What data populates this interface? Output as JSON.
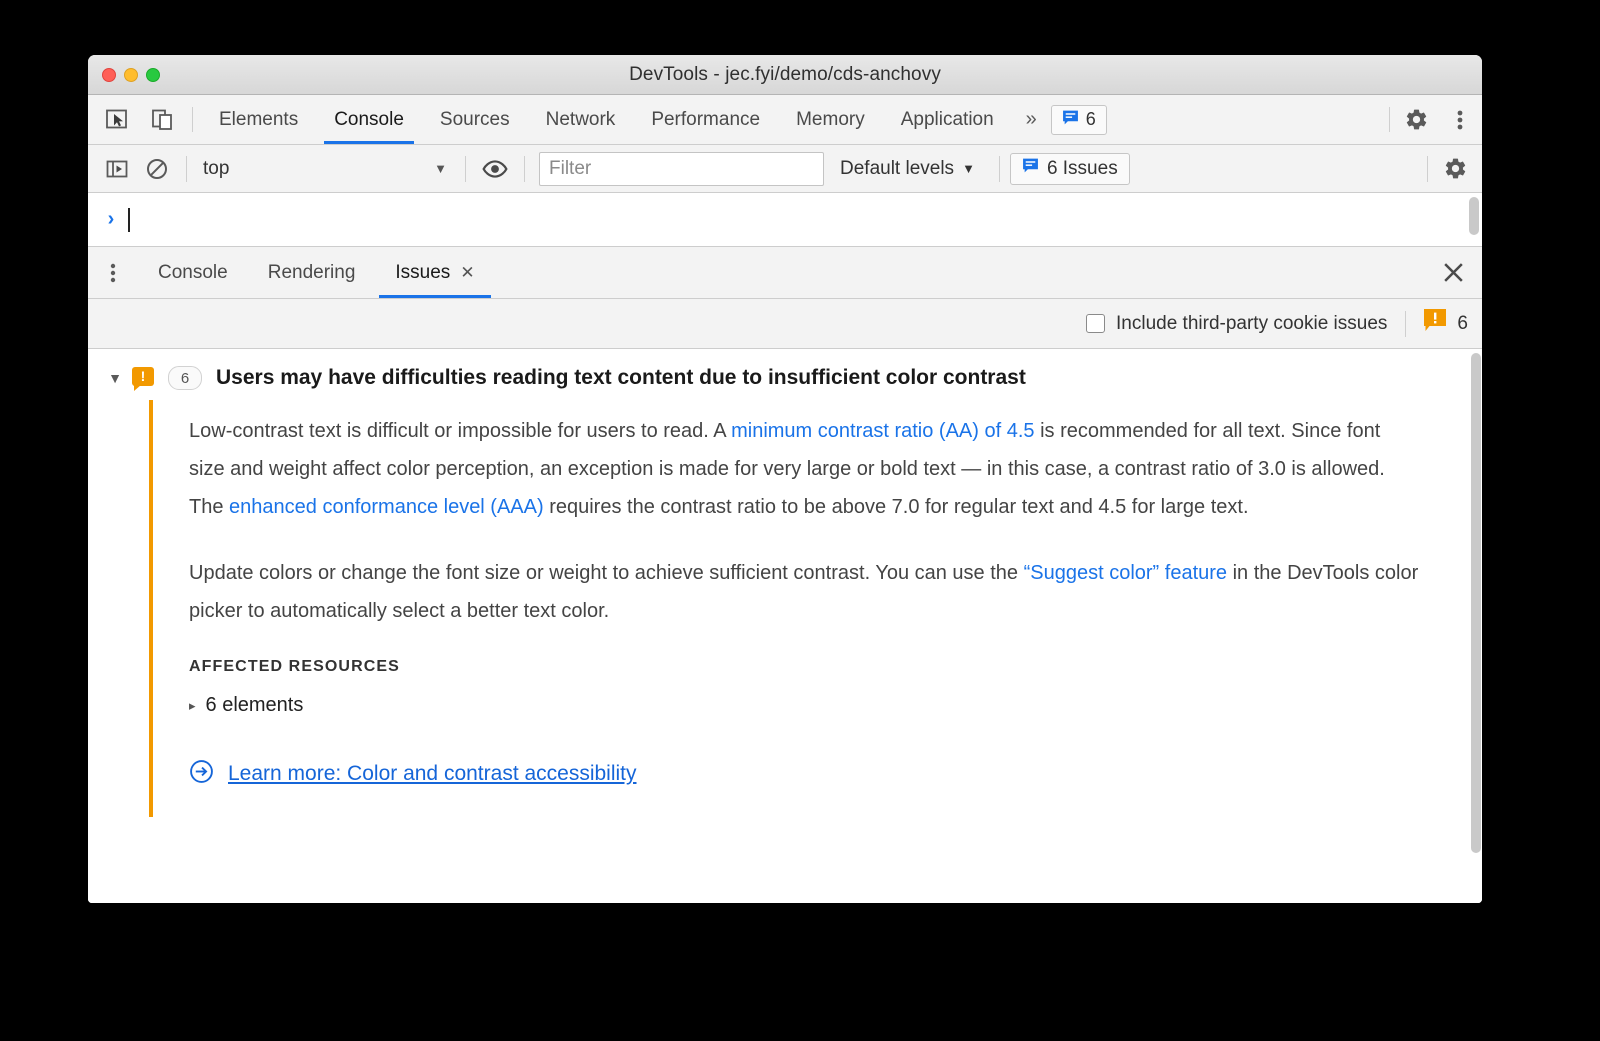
{
  "window": {
    "title": "DevTools - jec.fyi/demo/cds-anchovy",
    "traffic_lights": [
      "close",
      "minimize",
      "zoom"
    ]
  },
  "main_tabbar": {
    "icons": [
      "inspect-element-icon",
      "device-toolbar-icon"
    ],
    "tabs": [
      {
        "label": "Elements",
        "active": false
      },
      {
        "label": "Console",
        "active": true
      },
      {
        "label": "Sources",
        "active": false
      },
      {
        "label": "Network",
        "active": false
      },
      {
        "label": "Performance",
        "active": false
      },
      {
        "label": "Memory",
        "active": false
      },
      {
        "label": "Application",
        "active": false
      }
    ],
    "more_label": "»",
    "issues_badge": {
      "count": "6",
      "icon": "issue-message-icon"
    },
    "settings_icon": "gear-icon",
    "kebab_icon": "more-options-icon"
  },
  "console_toolbar": {
    "sidebar_toggle_icon": "console-sidebar-icon",
    "clear_icon": "clear-console-icon",
    "context": {
      "value": "top",
      "caret": "▼"
    },
    "eye_icon": "live-expression-icon",
    "filter": {
      "placeholder": "Filter",
      "value": ""
    },
    "levels": {
      "label": "Default levels",
      "caret": "▼"
    },
    "issues_button": {
      "label": "6 Issues",
      "icon": "issue-message-icon"
    },
    "settings_icon": "gear-icon"
  },
  "console_prompt": {
    "chevron": "›",
    "input_value": ""
  },
  "drawer": {
    "kebab_icon": "drawer-more-options-icon",
    "tabs": [
      {
        "label": "Console",
        "active": false,
        "closable": false
      },
      {
        "label": "Rendering",
        "active": false,
        "closable": false
      },
      {
        "label": "Issues",
        "active": true,
        "closable": true,
        "close_glyph": "✕"
      }
    ],
    "close_glyph": "✕"
  },
  "issues_bar": {
    "checkbox": {
      "label": "Include third-party cookie issues",
      "checked": false
    },
    "warning_count": "6",
    "warning_icon": "issue-warning-icon"
  },
  "issue": {
    "expand_glyph": "▼",
    "icon": "issue-warning-icon",
    "bang": "!",
    "count": "6",
    "title": "Users may have difficulties reading text content due to insufficient color contrast",
    "paragraph1": {
      "part1": "Low-contrast text is difficult or impossible for users to read. A ",
      "link1": "minimum contrast ratio (AA) of 4.5",
      "part2": " is recommended for all text. Since font size and weight affect color perception, an exception is made for very large or bold text — in this case, a contrast ratio of 3.0 is allowed. The ",
      "link2": "enhanced conformance level (AAA)",
      "part3": " requires the contrast ratio to be above 7.0 for regular text and 4.5 for large text."
    },
    "paragraph2": {
      "part1": "Update colors or change the font size or weight to achieve sufficient contrast. You can use the ",
      "link1": "“Suggest color” feature",
      "part2": " in the DevTools color picker to automatically select a better text color."
    },
    "affected_resources_label": "AFFECTED RESOURCES",
    "affected_resources_item": "6 elements",
    "affected_expand_glyph": "▸",
    "learn_more": {
      "label": "Learn more: Color and contrast accessibility",
      "icon": "arrow-circle-right-icon"
    }
  },
  "colors": {
    "accent_blue": "#1a73e8",
    "link_blue": "#1565d8",
    "warning_orange": "#f29900",
    "toolbar_bg": "#f3f3f3",
    "text": "#444444"
  }
}
